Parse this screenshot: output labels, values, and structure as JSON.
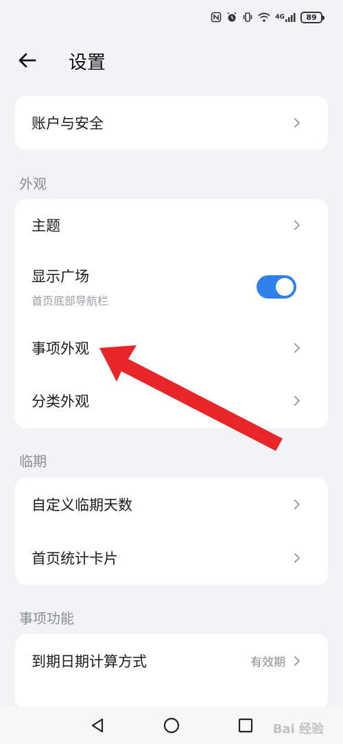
{
  "status_bar": {
    "network": "4G",
    "battery": "89",
    "icons": [
      "nfc-icon",
      "alarm-icon",
      "vibrate-icon",
      "wifi-icon",
      "signal-icon",
      "battery-icon"
    ]
  },
  "header": {
    "title": "设置",
    "back_icon": "arrow-left-icon"
  },
  "sections": {
    "account": {
      "items": [
        {
          "label": "账户与安全"
        }
      ]
    },
    "appearance": {
      "label": "外观",
      "items": [
        {
          "label": "主题"
        },
        {
          "label": "显示广场",
          "sub": "首页底部导航栏",
          "toggle": true
        },
        {
          "label": "事项外观"
        },
        {
          "label": "分类外观"
        }
      ]
    },
    "expiry": {
      "label": "临期",
      "items": [
        {
          "label": "自定义临期天数"
        },
        {
          "label": "首页统计卡片"
        }
      ]
    },
    "features": {
      "label": "事项功能",
      "items": [
        {
          "label": "到期日期计算方式",
          "value": "有效期"
        }
      ]
    }
  },
  "colors": {
    "background": "#f2f3f7",
    "card": "#ffffff",
    "accent": "#2f80ed",
    "annotation": "#e8262a"
  },
  "watermark": "Bai 经验"
}
